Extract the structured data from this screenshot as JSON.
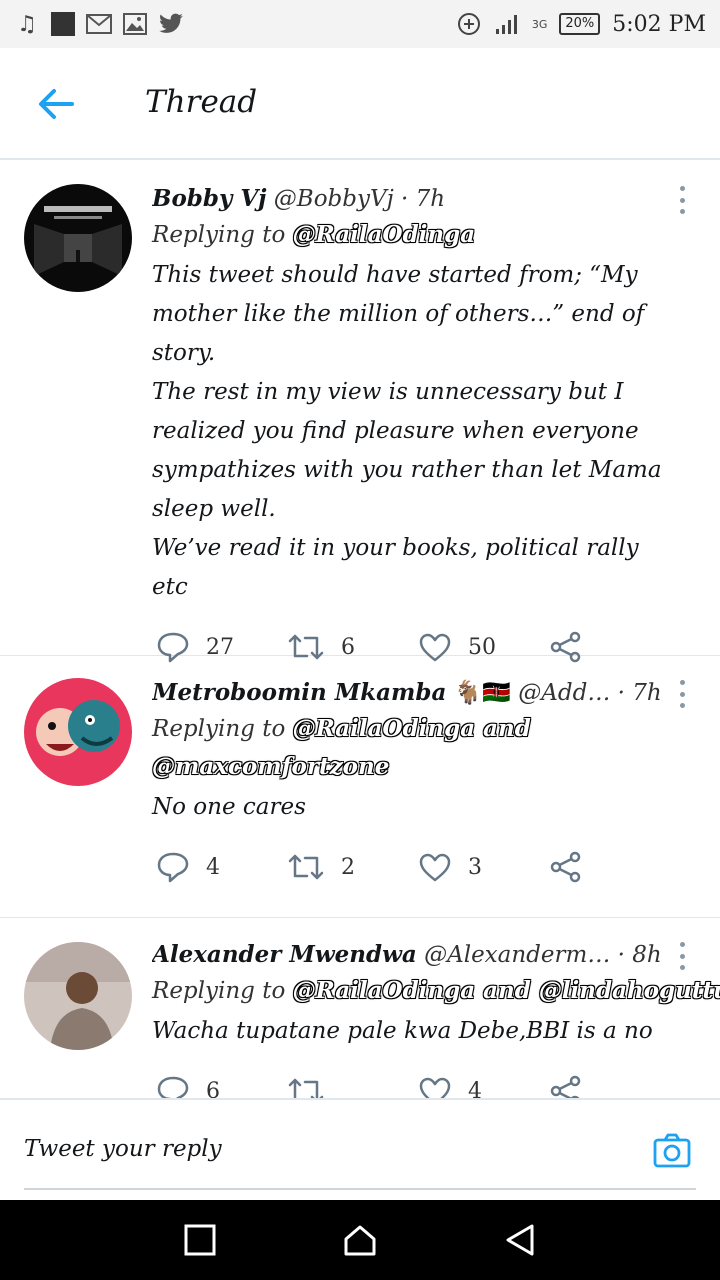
{
  "status_bar": {
    "time": "5:02 PM",
    "battery": "20%",
    "network": "3G",
    "icons_left": [
      "music-note-icon",
      "square-icon",
      "gmail-icon",
      "image-icon",
      "twitter-icon"
    ]
  },
  "header": {
    "title": "Thread"
  },
  "tweets": [
    {
      "name": "Bobby Vj",
      "handle": "@BobbyVj",
      "time": "7h",
      "reply_prefix": "Replying to ",
      "mentions": "@RailaOdinga",
      "text_lines": [
        "This tweet should have started from; “My mother like the million of others…” end of story.",
        "The rest in my view is unnecessary but I realized you find pleasure when everyone sympathizes with you rather than let Mama sleep well.",
        "We’ve read it in your books, political rally etc"
      ],
      "replies": "27",
      "retweets": "6",
      "likes": "50"
    },
    {
      "name": "Metroboomin Mkamba",
      "name_emoji": "🐐🇰🇪",
      "handle": "@Add…",
      "time": "7h",
      "reply_prefix": "Replying to ",
      "mentions": "@RailaOdinga and @maxcomfortzone",
      "text_lines": [
        "No one cares"
      ],
      "replies": "4",
      "retweets": "2",
      "likes": "3"
    },
    {
      "name": "Alexander Mwendwa",
      "handle": "@Alexanderm…",
      "time": "8h",
      "reply_prefix": "Replying to ",
      "mentions": "@RailaOdinga and @lindahoguttu",
      "text_lines": [
        "Wacha tupatane pale kwa Debe,BBI is a no"
      ],
      "replies": "6",
      "retweets": "",
      "likes": "4"
    }
  ],
  "reply_box": {
    "placeholder": "Tweet your reply"
  },
  "colors": {
    "accent": "#1da1f2",
    "icon_gray": "#657786"
  }
}
